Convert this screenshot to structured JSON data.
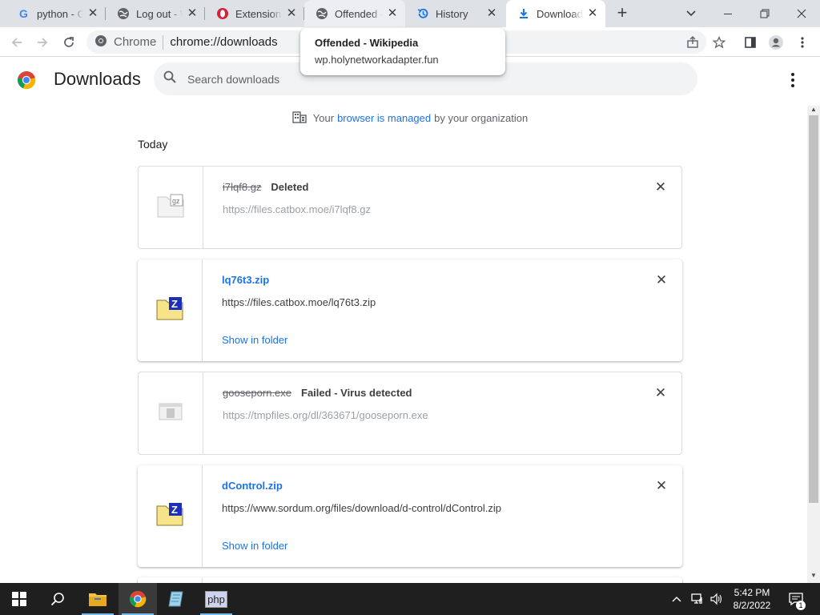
{
  "tabs": [
    {
      "title": "python - G",
      "favicon": "google-icon"
    },
    {
      "title": "Log out - W",
      "favicon": "globe-icon"
    },
    {
      "title": "Extensions",
      "favicon": "opera-icon"
    },
    {
      "title": "Offended - ",
      "favicon": "globe-icon"
    },
    {
      "title": "History",
      "favicon": "history-icon"
    },
    {
      "title": "Downloads",
      "favicon": "download-icon"
    }
  ],
  "toolbar": {
    "site_chip": "Chrome",
    "url": "chrome://downloads"
  },
  "hover_card": {
    "title": "Offended - Wikipedia",
    "url": "wp.holynetworkadapter.fun"
  },
  "page": {
    "title": "Downloads",
    "search_placeholder": "Search downloads",
    "managed_prefix": "Your",
    "managed_link": "browser is managed",
    "managed_suffix": "by your organization",
    "section_label": "Today"
  },
  "downloads": [
    {
      "name": "i7lqf8.gz",
      "status": "Deleted",
      "url": "https://files.catbox.moe/i7lqf8.gz",
      "state": "deleted"
    },
    {
      "name": "lq76t3.zip",
      "url": "https://files.catbox.moe/lq76t3.zip",
      "action": "Show in folder",
      "state": "complete"
    },
    {
      "name": "gooseporn.exe",
      "status": "Failed - Virus detected",
      "url": "https://tmpfiles.org/dl/363671/gooseporn.exe",
      "state": "failed"
    },
    {
      "name": "dControl.zip",
      "url": "https://www.sordum.org/files/download/d-control/dControl.zip",
      "action": "Show in folder",
      "state": "complete"
    }
  ],
  "taskbar": {
    "time": "5:42 PM",
    "date": "8/2/2022",
    "notification_count": "1",
    "php_label": "php"
  },
  "colors": {
    "accent": "#1a73e8",
    "tabstrip": "#dee1e6",
    "taskbar": "#1f1f1f"
  }
}
